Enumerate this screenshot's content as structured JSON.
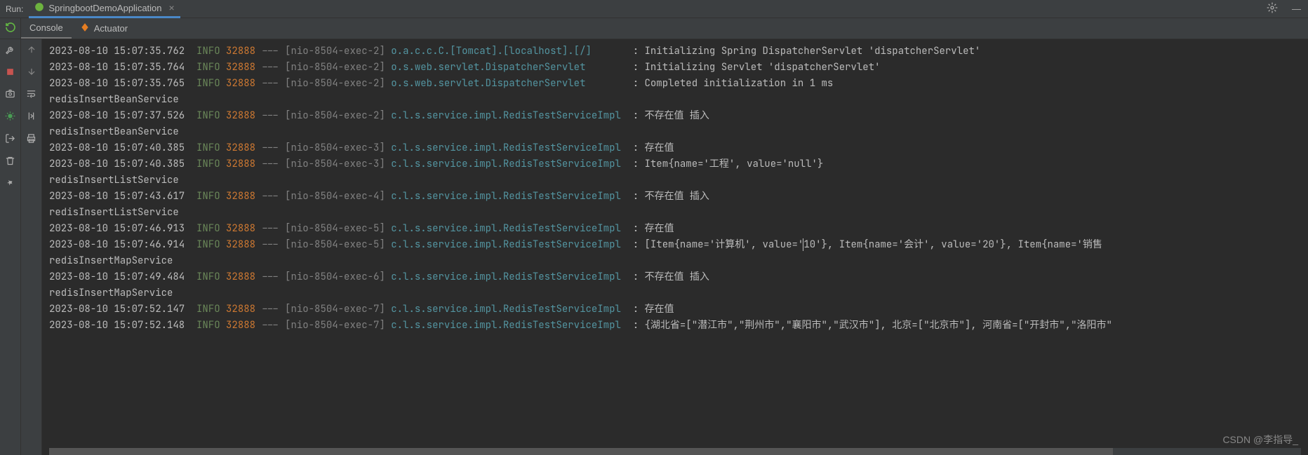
{
  "header": {
    "run_label": "Run:",
    "tab_name": "SpringbootDemoApplication"
  },
  "subtabs": {
    "console": "Console",
    "actuator": "Actuator"
  },
  "log_lines": [
    {
      "ts": "2023-08-10 15:07:35.762",
      "level": "INFO",
      "pid": "32888",
      "thread": "[nio-8504-exec-2]",
      "logger": "o.a.c.c.C.[Tomcat].[localhost].[/]     ",
      "msg": "Initializing Spring DispatcherServlet 'dispatcherServlet'"
    },
    {
      "ts": "2023-08-10 15:07:35.764",
      "level": "INFO",
      "pid": "32888",
      "thread": "[nio-8504-exec-2]",
      "logger": "o.s.web.servlet.DispatcherServlet      ",
      "msg": "Initializing Servlet 'dispatcherServlet'"
    },
    {
      "ts": "2023-08-10 15:07:35.765",
      "level": "INFO",
      "pid": "32888",
      "thread": "[nio-8504-exec-2]",
      "logger": "o.s.web.servlet.DispatcherServlet      ",
      "msg": "Completed initialization in 1 ms"
    },
    {
      "plain": "redisInsertBeanService"
    },
    {
      "ts": "2023-08-10 15:07:37.526",
      "level": "INFO",
      "pid": "32888",
      "thread": "[nio-8504-exec-2]",
      "logger": "c.l.s.service.impl.RedisTestServiceImpl",
      "msg": "不存在值 插入"
    },
    {
      "plain": "redisInsertBeanService"
    },
    {
      "ts": "2023-08-10 15:07:40.385",
      "level": "INFO",
      "pid": "32888",
      "thread": "[nio-8504-exec-3]",
      "logger": "c.l.s.service.impl.RedisTestServiceImpl",
      "msg": "存在值"
    },
    {
      "ts": "2023-08-10 15:07:40.385",
      "level": "INFO",
      "pid": "32888",
      "thread": "[nio-8504-exec-3]",
      "logger": "c.l.s.service.impl.RedisTestServiceImpl",
      "msg": "Item{name='工程', value='null'}"
    },
    {
      "plain": "redisInsertListService"
    },
    {
      "ts": "2023-08-10 15:07:43.617",
      "level": "INFO",
      "pid": "32888",
      "thread": "[nio-8504-exec-4]",
      "logger": "c.l.s.service.impl.RedisTestServiceImpl",
      "msg": "不存在值 插入"
    },
    {
      "plain": "redisInsertListService"
    },
    {
      "ts": "2023-08-10 15:07:46.913",
      "level": "INFO",
      "pid": "32888",
      "thread": "[nio-8504-exec-5]",
      "logger": "c.l.s.service.impl.RedisTestServiceImpl",
      "msg": "存在值"
    },
    {
      "ts": "2023-08-10 15:07:46.914",
      "level": "INFO",
      "pid": "32888",
      "thread": "[nio-8504-exec-5]",
      "logger": "c.l.s.service.impl.RedisTestServiceImpl",
      "msg_pre": "[Item{name='计算机', value='",
      "msg_caret": "1",
      "msg_post": "0'}, Item{name='会计', value='20'}, Item{name='销售"
    },
    {
      "plain": "redisInsertMapService"
    },
    {
      "ts": "2023-08-10 15:07:49.484",
      "level": "INFO",
      "pid": "32888",
      "thread": "[nio-8504-exec-6]",
      "logger": "c.l.s.service.impl.RedisTestServiceImpl",
      "msg": "不存在值 插入"
    },
    {
      "plain": "redisInsertMapService"
    },
    {
      "ts": "2023-08-10 15:07:52.147",
      "level": "INFO",
      "pid": "32888",
      "thread": "[nio-8504-exec-7]",
      "logger": "c.l.s.service.impl.RedisTestServiceImpl",
      "msg": "存在值"
    },
    {
      "ts": "2023-08-10 15:07:52.148",
      "level": "INFO",
      "pid": "32888",
      "thread": "[nio-8504-exec-7]",
      "logger": "c.l.s.service.impl.RedisTestServiceImpl",
      "msg": "{湖北省=[\"潜江市\",\"荆州市\",\"襄阳市\",\"武汉市\"], 北京=[\"北京市\"], 河南省=[\"开封市\",\"洛阳市\""
    }
  ],
  "watermark": "CSDN @李指导_"
}
